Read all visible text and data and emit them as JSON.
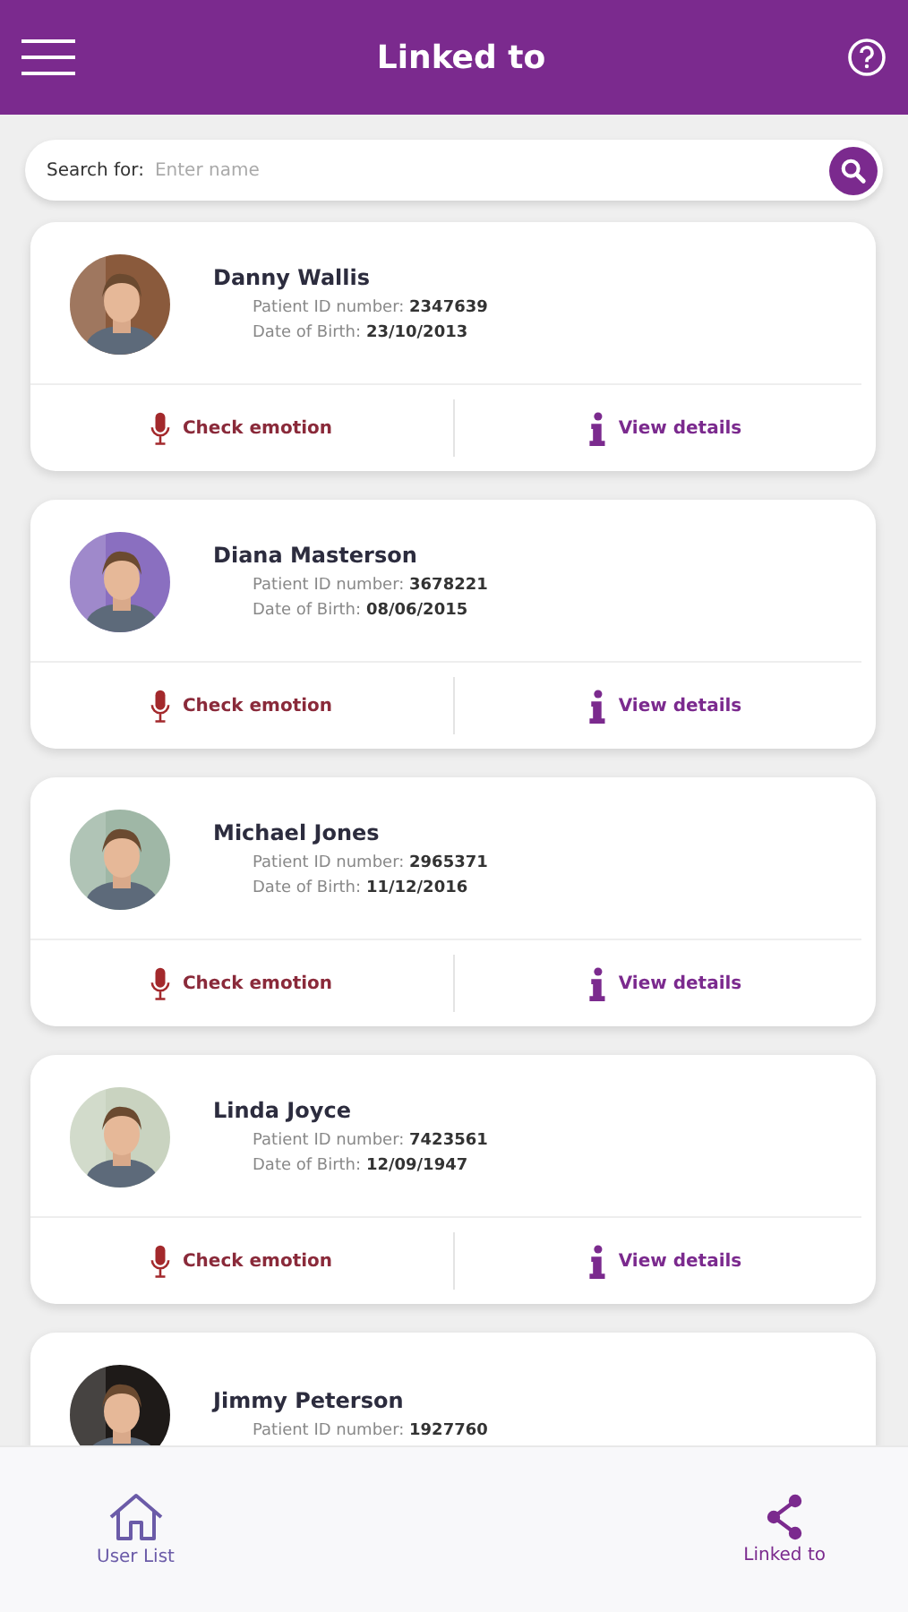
{
  "header": {
    "title": "Linked to"
  },
  "search": {
    "label": "Search for:",
    "placeholder": "Enter name"
  },
  "patients": [
    {
      "name": "Danny Wallis",
      "id_label": "Patient ID number:",
      "id": "2347639",
      "dob_label": "Date of Birth:",
      "dob": "23/10/2013",
      "actions": [
        "Check emotion",
        "View details"
      ]
    },
    {
      "name": "Diana Masterson",
      "id_label": "Patient ID number:",
      "id": "3678221",
      "dob_label": "Date of Birth:",
      "dob": "08/06/2015",
      "actions": [
        "Check emotion",
        "View details"
      ]
    },
    {
      "name": "Michael Jones",
      "id_label": "Patient ID number:",
      "id": "2965371",
      "dob_label": "Date of Birth:",
      "dob": "11/12/2016",
      "actions": [
        "Check emotion",
        "View details"
      ]
    },
    {
      "name": "Linda Joyce",
      "id_label": "Patient ID number:",
      "id": "7423561",
      "dob_label": "Date of Birth:",
      "dob": "12/09/1947",
      "actions": [
        "Check emotion",
        "View details"
      ]
    },
    {
      "name": "Jimmy Peterson",
      "id_label": "Patient ID number:",
      "id": "1927760"
    }
  ],
  "nav": [
    {
      "label": "User List",
      "selected": false
    },
    {
      "label": "Linked to",
      "selected": true
    }
  ]
}
